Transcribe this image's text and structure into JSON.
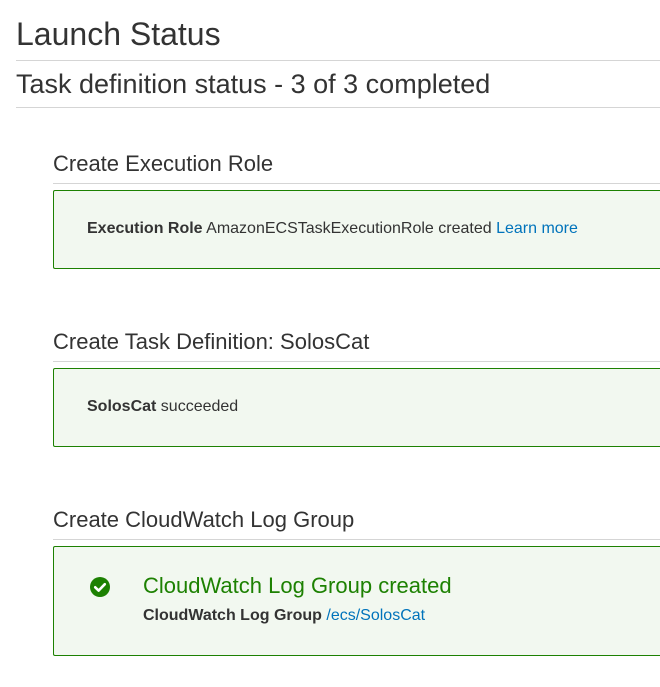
{
  "page": {
    "title": "Launch Status",
    "status_heading": "Task definition status - 3 of 3 completed"
  },
  "sections": [
    {
      "title": "Create Execution Role",
      "label": "Execution Role",
      "message": "AmazonECSTaskExecutionRole created",
      "link": "Learn more"
    },
    {
      "title": "Create Task Definition: SolosCat",
      "label": "SolosCat",
      "message": "succeeded"
    },
    {
      "title": "Create CloudWatch Log Group",
      "success_title": "CloudWatch Log Group created",
      "label": "CloudWatch Log Group",
      "link": "/ecs/SolosCat",
      "icon": "check-circle-icon"
    }
  ],
  "colors": {
    "success": "#1d8102",
    "success_bg": "#f2f8f0",
    "link": "#0073bb",
    "text": "#333333",
    "divider": "#d5d5d5"
  }
}
